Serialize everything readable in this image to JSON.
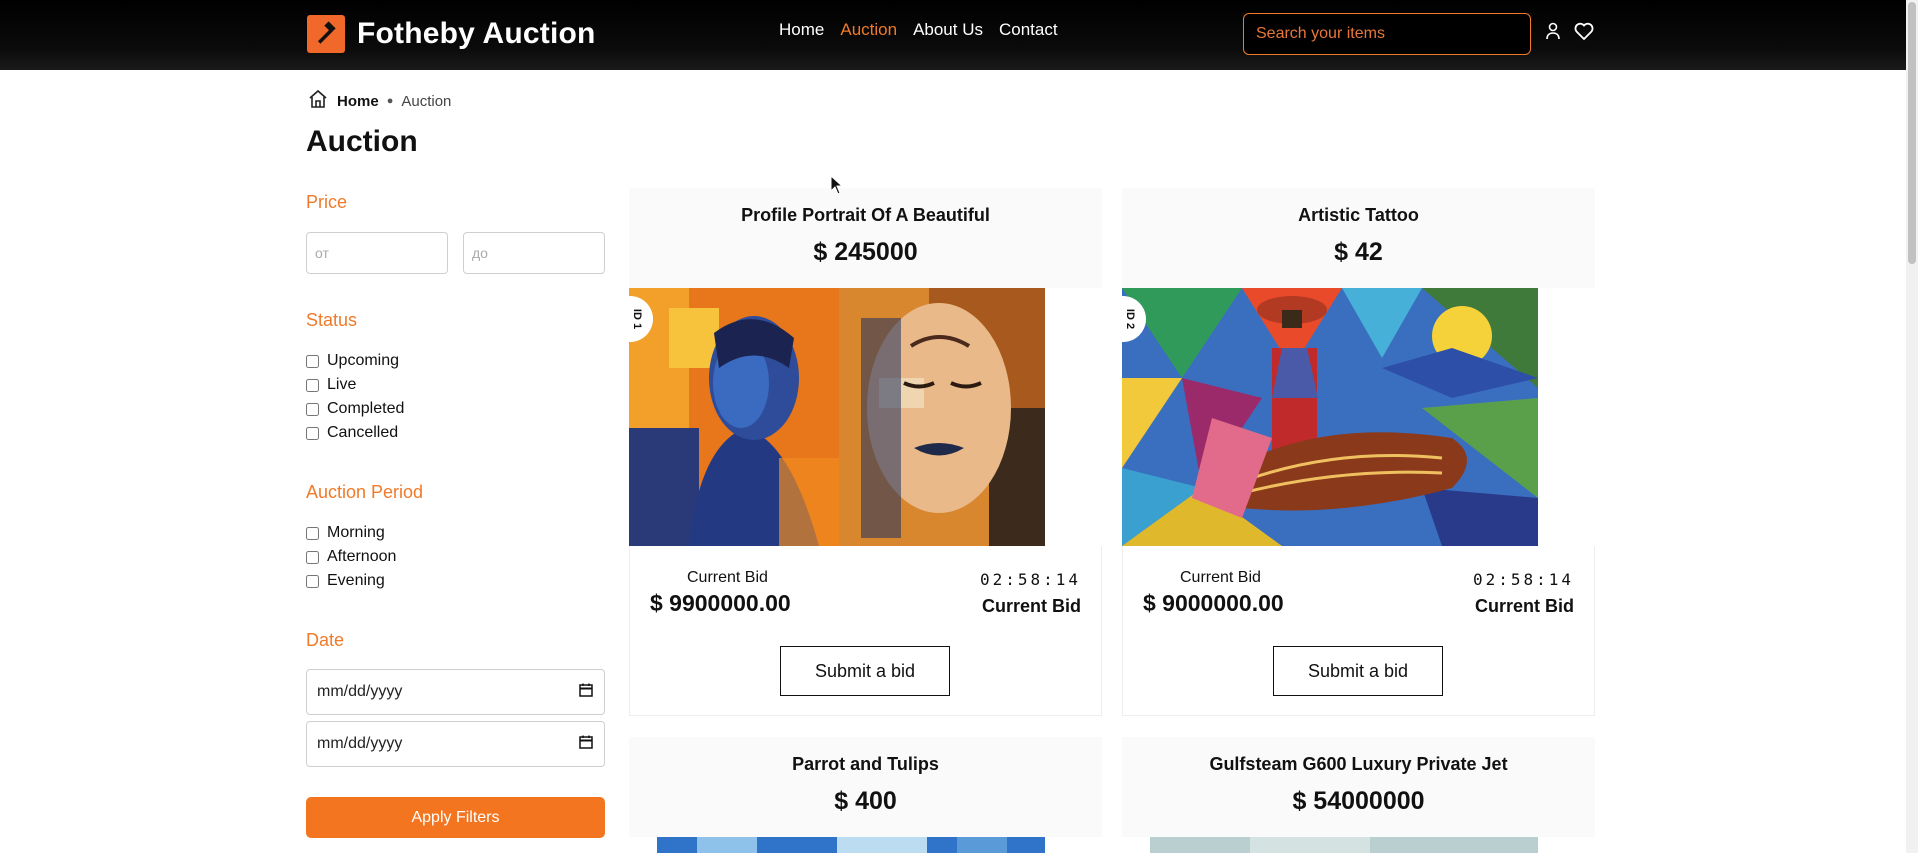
{
  "header": {
    "brand_name": "Fotheby Auction",
    "nav": [
      "Home",
      "Auction",
      "About Us",
      "Contact"
    ],
    "active_nav": "Auction",
    "search_placeholder": "Search your items",
    "accent_color": "#f07a2a"
  },
  "breadcrumb": {
    "home": "Home",
    "current": "Auction"
  },
  "page_title": "Auction",
  "filters": {
    "price": {
      "heading": "Price",
      "from_placeholder": "от",
      "to_placeholder": "до"
    },
    "status": {
      "heading": "Status",
      "options": [
        "Upcoming",
        "Live",
        "Completed",
        "Cancelled"
      ]
    },
    "period": {
      "heading": "Auction Period",
      "options": [
        "Morning",
        "Afternoon",
        "Evening"
      ]
    },
    "date": {
      "heading": "Date",
      "placeholder": "mm/dd/yyyy"
    },
    "apply_label": "Apply Filters"
  },
  "cards": [
    {
      "title": "Profile Portrait Of A Beautiful",
      "price": "$ 245000",
      "id_label": "ID 1",
      "bid_label": "Current Bid",
      "bid_amount": "$ 9900000.00",
      "timer": "02:58:14",
      "bid_right": "Current Bid",
      "button": "Submit a bid"
    },
    {
      "title": "Artistic Tattoo",
      "price": "$ 42",
      "id_label": "ID 2",
      "bid_label": "Current Bid",
      "bid_amount": "$ 9000000.00",
      "timer": "02:58:14",
      "bid_right": "Current Bid",
      "button": "Submit a bid"
    },
    {
      "title": "Parrot and Tulips",
      "price": "$ 400"
    },
    {
      "title": "Gulfsteam G600 Luxury Private Jet",
      "price": "$ 54000000"
    }
  ]
}
